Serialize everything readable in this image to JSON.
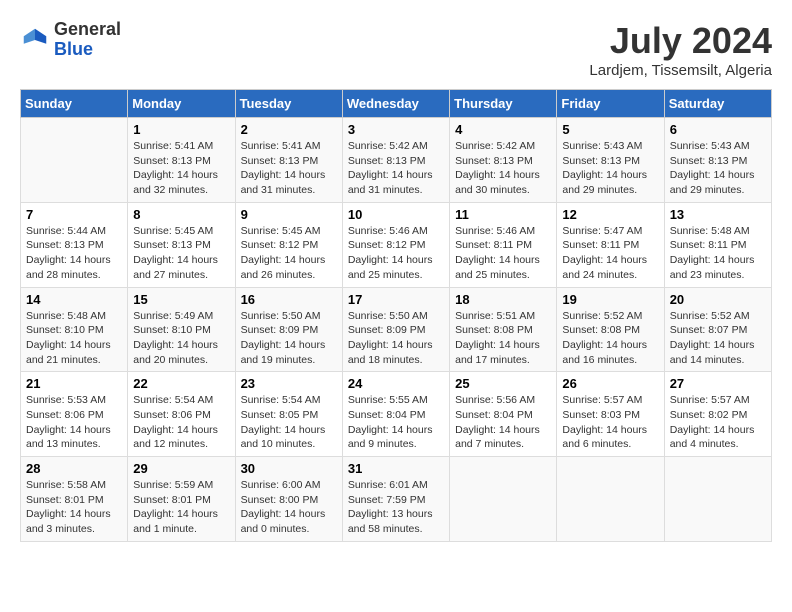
{
  "header": {
    "logo": {
      "general": "General",
      "blue": "Blue"
    },
    "title": "July 2024",
    "subtitle": "Lardjem, Tissemsilt, Algeria"
  },
  "calendar": {
    "days_of_week": [
      "Sunday",
      "Monday",
      "Tuesday",
      "Wednesday",
      "Thursday",
      "Friday",
      "Saturday"
    ],
    "weeks": [
      [
        {
          "day": "",
          "info": ""
        },
        {
          "day": "1",
          "info": "Sunrise: 5:41 AM\nSunset: 8:13 PM\nDaylight: 14 hours\nand 32 minutes."
        },
        {
          "day": "2",
          "info": "Sunrise: 5:41 AM\nSunset: 8:13 PM\nDaylight: 14 hours\nand 31 minutes."
        },
        {
          "day": "3",
          "info": "Sunrise: 5:42 AM\nSunset: 8:13 PM\nDaylight: 14 hours\nand 31 minutes."
        },
        {
          "day": "4",
          "info": "Sunrise: 5:42 AM\nSunset: 8:13 PM\nDaylight: 14 hours\nand 30 minutes."
        },
        {
          "day": "5",
          "info": "Sunrise: 5:43 AM\nSunset: 8:13 PM\nDaylight: 14 hours\nand 29 minutes."
        },
        {
          "day": "6",
          "info": "Sunrise: 5:43 AM\nSunset: 8:13 PM\nDaylight: 14 hours\nand 29 minutes."
        }
      ],
      [
        {
          "day": "7",
          "info": "Sunrise: 5:44 AM\nSunset: 8:13 PM\nDaylight: 14 hours\nand 28 minutes."
        },
        {
          "day": "8",
          "info": "Sunrise: 5:45 AM\nSunset: 8:13 PM\nDaylight: 14 hours\nand 27 minutes."
        },
        {
          "day": "9",
          "info": "Sunrise: 5:45 AM\nSunset: 8:12 PM\nDaylight: 14 hours\nand 26 minutes."
        },
        {
          "day": "10",
          "info": "Sunrise: 5:46 AM\nSunset: 8:12 PM\nDaylight: 14 hours\nand 25 minutes."
        },
        {
          "day": "11",
          "info": "Sunrise: 5:46 AM\nSunset: 8:11 PM\nDaylight: 14 hours\nand 25 minutes."
        },
        {
          "day": "12",
          "info": "Sunrise: 5:47 AM\nSunset: 8:11 PM\nDaylight: 14 hours\nand 24 minutes."
        },
        {
          "day": "13",
          "info": "Sunrise: 5:48 AM\nSunset: 8:11 PM\nDaylight: 14 hours\nand 23 minutes."
        }
      ],
      [
        {
          "day": "14",
          "info": "Sunrise: 5:48 AM\nSunset: 8:10 PM\nDaylight: 14 hours\nand 21 minutes."
        },
        {
          "day": "15",
          "info": "Sunrise: 5:49 AM\nSunset: 8:10 PM\nDaylight: 14 hours\nand 20 minutes."
        },
        {
          "day": "16",
          "info": "Sunrise: 5:50 AM\nSunset: 8:09 PM\nDaylight: 14 hours\nand 19 minutes."
        },
        {
          "day": "17",
          "info": "Sunrise: 5:50 AM\nSunset: 8:09 PM\nDaylight: 14 hours\nand 18 minutes."
        },
        {
          "day": "18",
          "info": "Sunrise: 5:51 AM\nSunset: 8:08 PM\nDaylight: 14 hours\nand 17 minutes."
        },
        {
          "day": "19",
          "info": "Sunrise: 5:52 AM\nSunset: 8:08 PM\nDaylight: 14 hours\nand 16 minutes."
        },
        {
          "day": "20",
          "info": "Sunrise: 5:52 AM\nSunset: 8:07 PM\nDaylight: 14 hours\nand 14 minutes."
        }
      ],
      [
        {
          "day": "21",
          "info": "Sunrise: 5:53 AM\nSunset: 8:06 PM\nDaylight: 14 hours\nand 13 minutes."
        },
        {
          "day": "22",
          "info": "Sunrise: 5:54 AM\nSunset: 8:06 PM\nDaylight: 14 hours\nand 12 minutes."
        },
        {
          "day": "23",
          "info": "Sunrise: 5:54 AM\nSunset: 8:05 PM\nDaylight: 14 hours\nand 10 minutes."
        },
        {
          "day": "24",
          "info": "Sunrise: 5:55 AM\nSunset: 8:04 PM\nDaylight: 14 hours\nand 9 minutes."
        },
        {
          "day": "25",
          "info": "Sunrise: 5:56 AM\nSunset: 8:04 PM\nDaylight: 14 hours\nand 7 minutes."
        },
        {
          "day": "26",
          "info": "Sunrise: 5:57 AM\nSunset: 8:03 PM\nDaylight: 14 hours\nand 6 minutes."
        },
        {
          "day": "27",
          "info": "Sunrise: 5:57 AM\nSunset: 8:02 PM\nDaylight: 14 hours\nand 4 minutes."
        }
      ],
      [
        {
          "day": "28",
          "info": "Sunrise: 5:58 AM\nSunset: 8:01 PM\nDaylight: 14 hours\nand 3 minutes."
        },
        {
          "day": "29",
          "info": "Sunrise: 5:59 AM\nSunset: 8:01 PM\nDaylight: 14 hours\nand 1 minute."
        },
        {
          "day": "30",
          "info": "Sunrise: 6:00 AM\nSunset: 8:00 PM\nDaylight: 14 hours\nand 0 minutes."
        },
        {
          "day": "31",
          "info": "Sunrise: 6:01 AM\nSunset: 7:59 PM\nDaylight: 13 hours\nand 58 minutes."
        },
        {
          "day": "",
          "info": ""
        },
        {
          "day": "",
          "info": ""
        },
        {
          "day": "",
          "info": ""
        }
      ]
    ]
  }
}
